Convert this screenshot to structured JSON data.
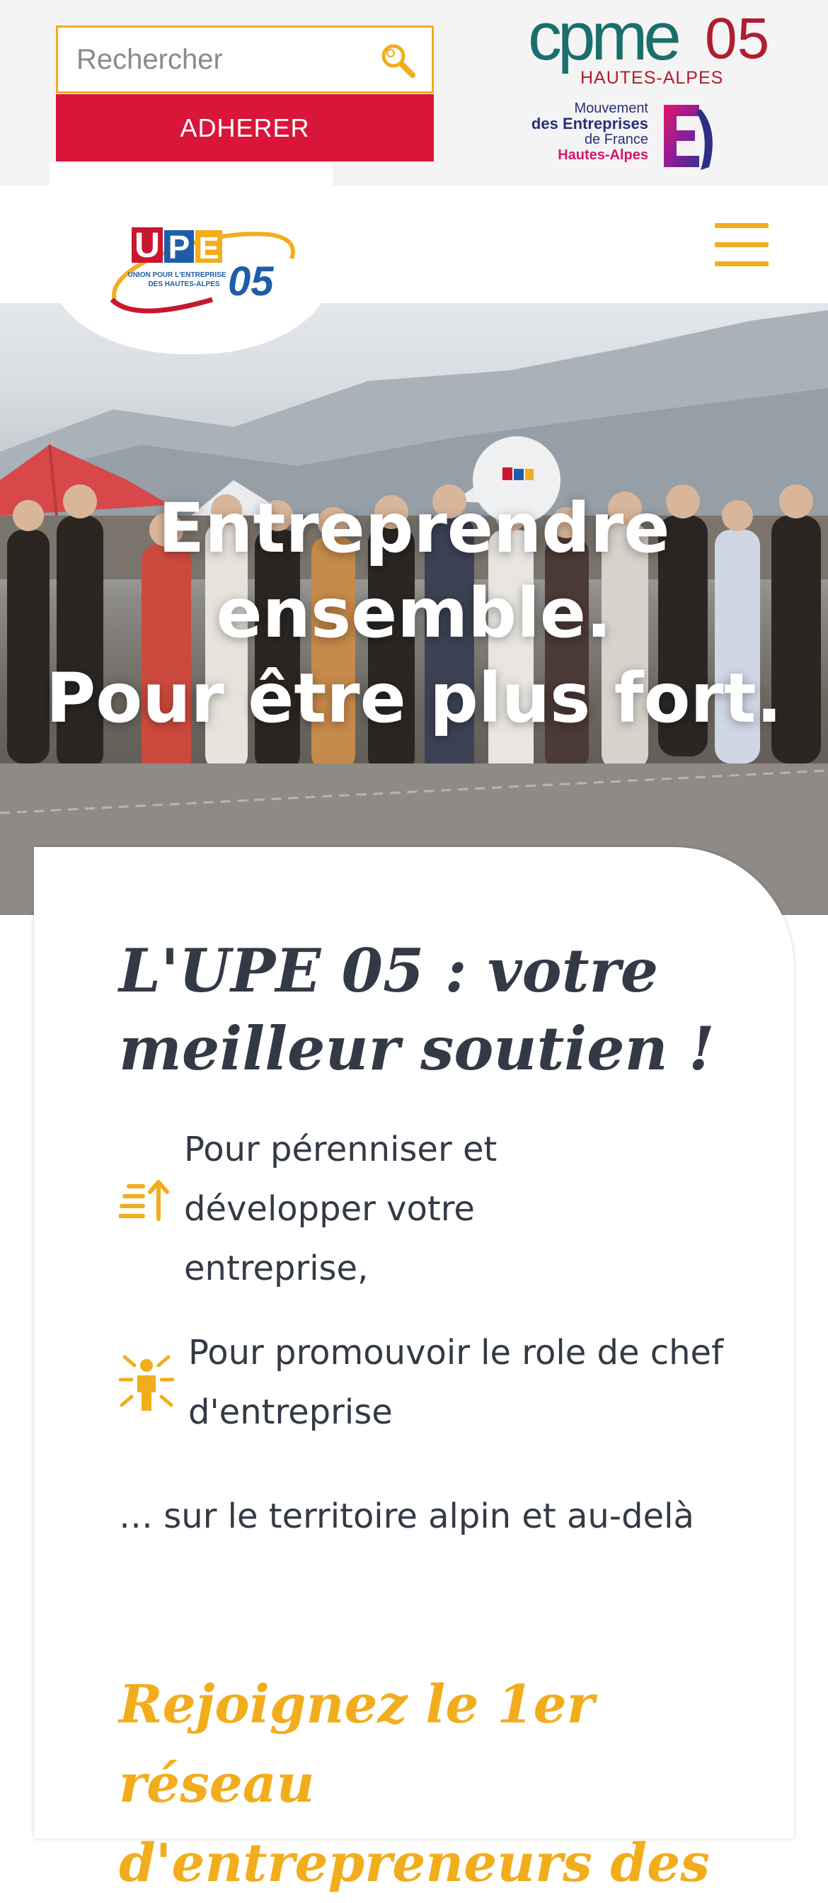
{
  "topbar": {
    "search_placeholder": "Rechercher",
    "adherer_label": "ADHERER",
    "cpme": {
      "word": "cpme",
      "number": "05",
      "subtitle": "HAUTES-ALPES"
    },
    "medef": {
      "line1": "Mouvement",
      "line2": "des Entreprises",
      "line3": "de France",
      "line4": "Hautes-Alpes"
    }
  },
  "header": {
    "logo": {
      "letters": [
        "U",
        "P",
        "E"
      ],
      "number": "05",
      "line1": "UNION POUR L'ENTREPRISE",
      "line2": "DES HAUTES-ALPES"
    },
    "menu_icon": "hamburger-icon"
  },
  "hero": {
    "title_lines": [
      "Entreprendre",
      "ensemble.",
      "Pour être plus fort."
    ]
  },
  "intro": {
    "title": "L'UPE 05 : votre meilleur soutien !",
    "items": [
      {
        "icon": "growth-arrow-icon",
        "text": "Pour pérenniser et développer votre entreprise,"
      },
      {
        "icon": "leader-person-icon",
        "text": "Pour promouvoir le role de chef d'entreprise"
      }
    ],
    "closing": "… sur le territoire alpin et au-delà",
    "cta_title": "Rejoignez le 1er réseau d'entrepreneurs des"
  },
  "colors": {
    "accent_yellow": "#f2ad1d",
    "brand_red": "#d9163a",
    "cpme_teal": "#1a6f6c",
    "text_dark": "#333a45",
    "upe_blue": "#1f5da8"
  }
}
